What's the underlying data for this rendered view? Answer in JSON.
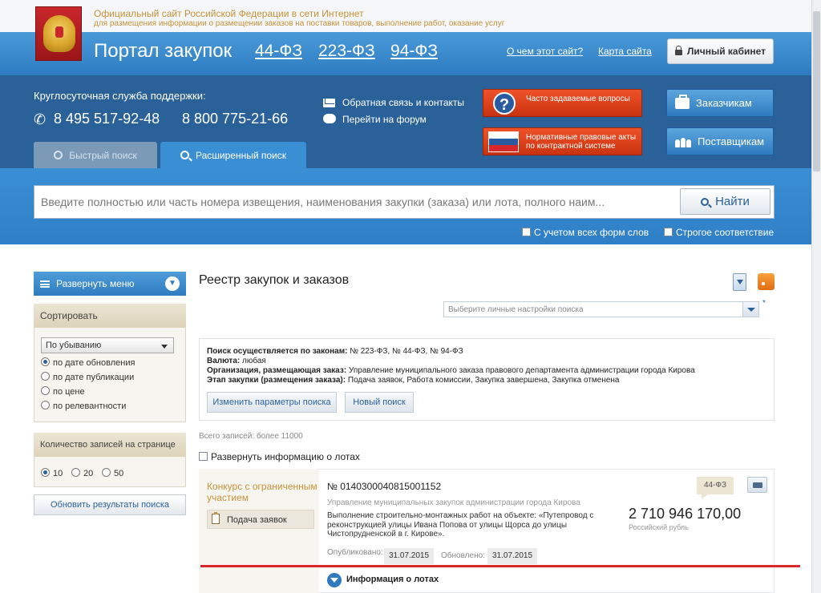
{
  "header": {
    "site_line1": "Официальный сайт Российской Федерации в сети Интернет",
    "site_line2": "для размещения информации о размещении заказов на поставки товаров, выполнение работ, оказание услуг",
    "portal_title": "Портал закупок",
    "law_links": [
      "44-ФЗ",
      "223-ФЗ",
      "94-ФЗ"
    ],
    "about_link": "О чем этот сайт?",
    "sitemap_link": "Карта сайта",
    "cabinet_label": "Личный кабинет"
  },
  "support": {
    "label": "Круглосуточная служба поддержки:",
    "phone1": "8 495 517-92-48",
    "phone2": "8 800 775-21-66",
    "feedback_link": "Обратная связь и контакты",
    "forum_link": "Перейти на форум",
    "faq_label": "Часто задаваемые вопросы",
    "acts_label": "Нормативные правовые акты по контрактной системе",
    "customers_label": "Заказчикам",
    "suppliers_label": "Поставщикам"
  },
  "tabs": {
    "quick": "Быстрый поиск",
    "extended": "Расширенный поиск"
  },
  "search": {
    "placeholder": "Введите полностью или часть номера извещения, наименования закупки (заказа) или лота, полного наим...",
    "button": "Найти",
    "option_all_forms": "С учетом всех форм слов",
    "option_strict": "Строгое соответствие"
  },
  "sidebar": {
    "expand_menu": "Развернуть меню",
    "sort_title": "Сортировать",
    "sort_order": "По убыванию",
    "sort_options": [
      "по дате обновления",
      "по дате публикации",
      "по цене",
      "по релевантности"
    ],
    "count_title": "Количество записей на странице",
    "count_options": [
      "10",
      "20",
      "50"
    ],
    "update_button": "Обновить результаты поиска"
  },
  "main": {
    "title": "Реестр закупок и заказов",
    "settings_placeholder": "Выберите личные настройки поиска",
    "asterisk": "*",
    "params": [
      {
        "label": "Поиск осуществляется по законам:",
        "value": "№ 223-ФЗ, № 44-ФЗ, № 94-ФЗ"
      },
      {
        "label": "Валюта:",
        "value": "любая"
      },
      {
        "label": "Организация, размещающая заказ:",
        "value": "Управление муниципального заказа правового департамента администрации города Кирова"
      },
      {
        "label": "Этап закупки (размещения заказа):",
        "value": "Подача заявок, Работа комиссии, Закупка завершена, Закупка отменена"
      }
    ],
    "change_params_button": "Изменить параметры поиска",
    "new_search_button": "Новый поиск",
    "total_records": "Всего записей: более 11000",
    "expand_lots": "Развернуть информацию о лотах"
  },
  "result": {
    "procurement_type": "Конкурс с ограниченным участием",
    "stage": "Подача заявок",
    "notice_number": "№ 0140300040815001152",
    "organization": "Управление муниципальных закупок администрации города Кирова",
    "description": "Выполнение строительно-монтажных работ на объекте: «Путепровод с реконструкцией улицы Ивана Попова от улицы Щорса до улицы Чистопрудненской в г. Кирове».",
    "published_label": "Опубликовано:",
    "published_date": "31.07.2015",
    "updated_label": "Обновлено:",
    "updated_date": "31.07.2015",
    "price": "2 710 946 170,00",
    "currency": "Российский рубль",
    "law_badge": "44-ФЗ",
    "lots_info": "Информация о лотах"
  },
  "colors": {
    "header_blue": "#2e7cc2",
    "dark_blue": "#2b6199",
    "accent_red": "#d9262c",
    "gold_text": "#c6923a"
  }
}
